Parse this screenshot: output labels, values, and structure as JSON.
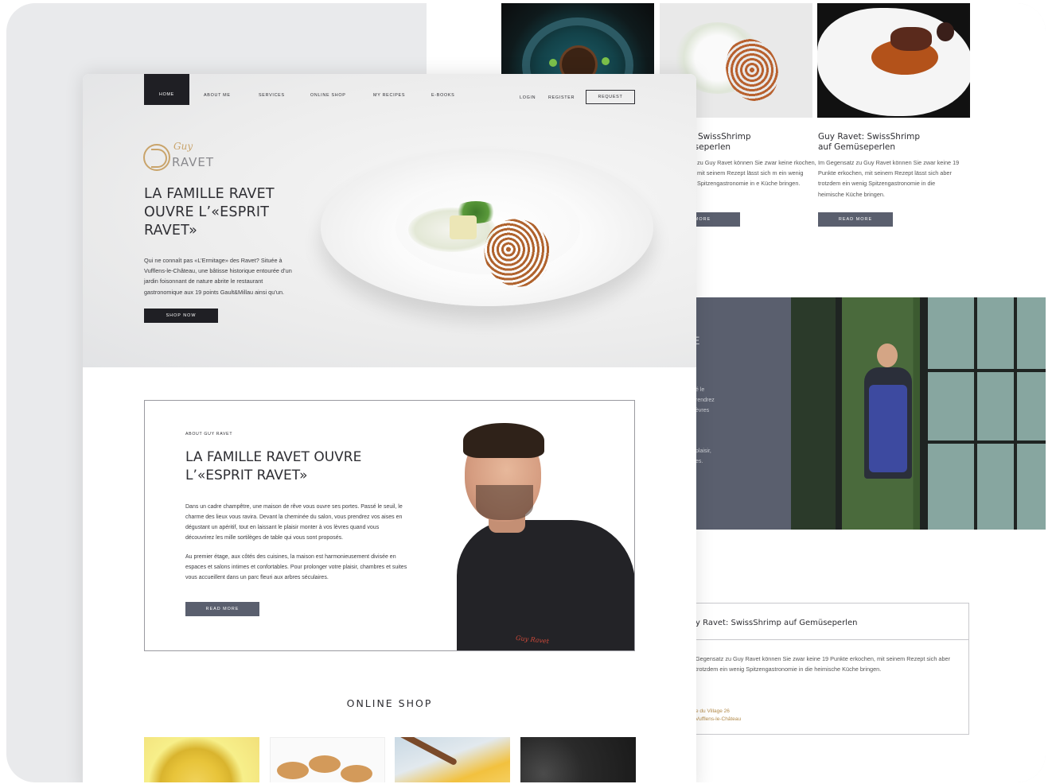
{
  "back": {
    "cards": [
      {
        "title_line1": "t: SwissShrimp",
        "title_line2": "üseperlen",
        "text": "zu Guy Ravet können Sie zwar keine rkochen, mit seinem Rezept lässt sich m ein wenig Spitzengastronomie in e Küche bringen.",
        "button": "MORE"
      },
      {
        "title_line1": "Guy Ravet: SwissShrimp",
        "title_line2": "auf Gemüseperlen",
        "text": "Im Gegensatz zu Guy Ravet können Sie zwar keine 19 Punkte erkochen, mit seinem Rezept lässt sich aber trotzdem ein wenig Spitzengastronomie in die heimische Küche bringen.",
        "button": "READ MORE"
      }
    ],
    "band_text": [
      "E",
      "é le",
      "rendrez",
      "èvres",
      "plaisir,",
      "es."
    ],
    "box": {
      "title": "y Ravet: SwissShrimp auf Gemüseperlen",
      "text": "Gegensatz zu Guy Ravet können Sie zwar keine 19 Punkte erkochen, mit seinem Rezept sich aber trotzdem ein wenig Spitzengastronomie in die heimische Küche bringen.",
      "address_line1": "e du Village 26",
      "address_line2": "Vufflens-le-Château"
    }
  },
  "front": {
    "nav": {
      "home": "HOME",
      "items": [
        "ABOUT ME",
        "SERVICES",
        "ONLINE SHOP",
        "MY RECIPES",
        "E-BOOKS"
      ],
      "login": "LOGIN",
      "register": "REGISTER",
      "request": "REQUEST"
    },
    "logo": {
      "script": "Guy",
      "word": "RAVET"
    },
    "hero": {
      "title": "LA FAMILLE RAVET OUVRE L’«ESPRIT RAVET»",
      "text": "Qui ne connaît pas «L’Ermitage» des Ravet? Située à Vufflens-le-Château, une bâtisse historique entourée d’un jardin foisonnant de nature abrite le restaurant gastronomique aux 19 points Gault&Millau ainsi qu’un.",
      "button": "SHOP NOW"
    },
    "about": {
      "kicker": "ABOUT GUY RAVET",
      "title": "LA FAMILLE RAVET OUVRE L’«ESPRIT RAVET»",
      "p1": "Dans un cadre champêtre, une maison de rêve vous ouvre ses portes. Passé le seuil, le charme des lieux vous ravira. Devant la cheminée du salon, vous prendrez vos aises en dégustant un apéritif, tout en laissant le plaisir monter à vos lèvres quand vous découvrirez les mille sortilèges de table qui vous sont proposés.",
      "p2": "Au premier étage, aux côtés des cuisines, la maison est harmonieusement divisée en espaces et salons intimes et confortables. Pour prolonger votre plaisir, chambres et suites vous accueillent dans un parc fleuri aux arbres séculaires.",
      "button": "READ MORE",
      "signature": "Guy Ravet"
    },
    "shop": {
      "heading": "ONLINE SHOP"
    }
  }
}
